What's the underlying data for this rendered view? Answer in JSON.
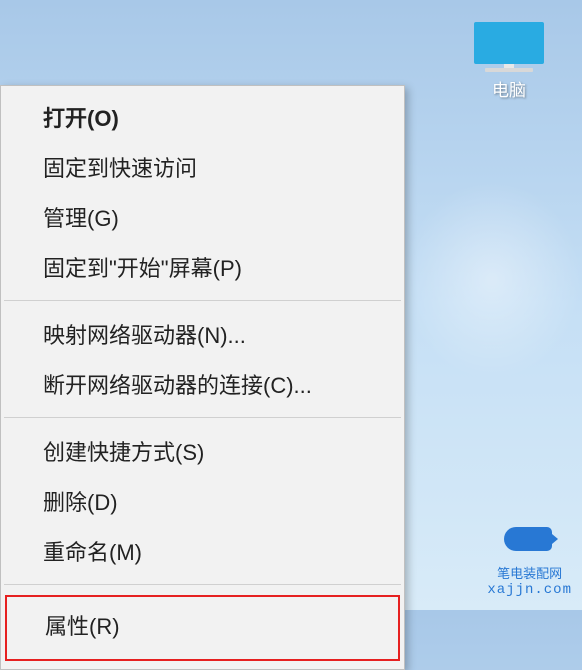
{
  "desktop": {
    "computer_label": "电脑"
  },
  "context_menu": {
    "open": "打开(O)",
    "pin_quick_access": "固定到快速访问",
    "manage": "管理(G)",
    "pin_start": "固定到\"开始\"屏幕(P)",
    "map_drive": "映射网络驱动器(N)...",
    "disconnect_drive": "断开网络驱动器的连接(C)...",
    "create_shortcut": "创建快捷方式(S)",
    "delete": "删除(D)",
    "rename": "重命名(M)",
    "properties": "属性(R)"
  },
  "watermark": {
    "text1": "笔电装配网",
    "text2": "xajjn.com"
  }
}
